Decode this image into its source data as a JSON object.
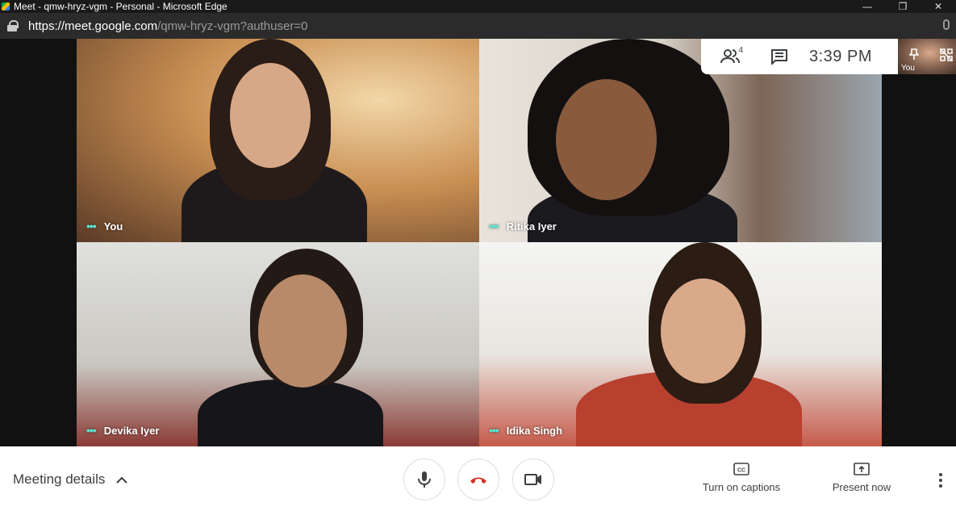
{
  "window": {
    "title": "Meet - qmw-hryz-vgm - Personal - Microsoft Edge",
    "controls": [
      "minimize",
      "restore",
      "close"
    ]
  },
  "address": {
    "host": "https://meet.google.com",
    "path": "/qmw-hryz-vgm?authuser=0"
  },
  "participants": [
    {
      "name": "You"
    },
    {
      "name": "Ritika Iyer"
    },
    {
      "name": "Devika Iyer"
    },
    {
      "name": "Idika Singh"
    }
  ],
  "panel": {
    "people_count": "4",
    "clock": "3:39 PM",
    "self_label": "You"
  },
  "bottom": {
    "meeting_details": "Meeting details",
    "captions_label": "Turn on captions",
    "present_label": "Present now"
  },
  "colors": {
    "accent_dots": "#5be3d0",
    "hangup": "#d93025"
  }
}
